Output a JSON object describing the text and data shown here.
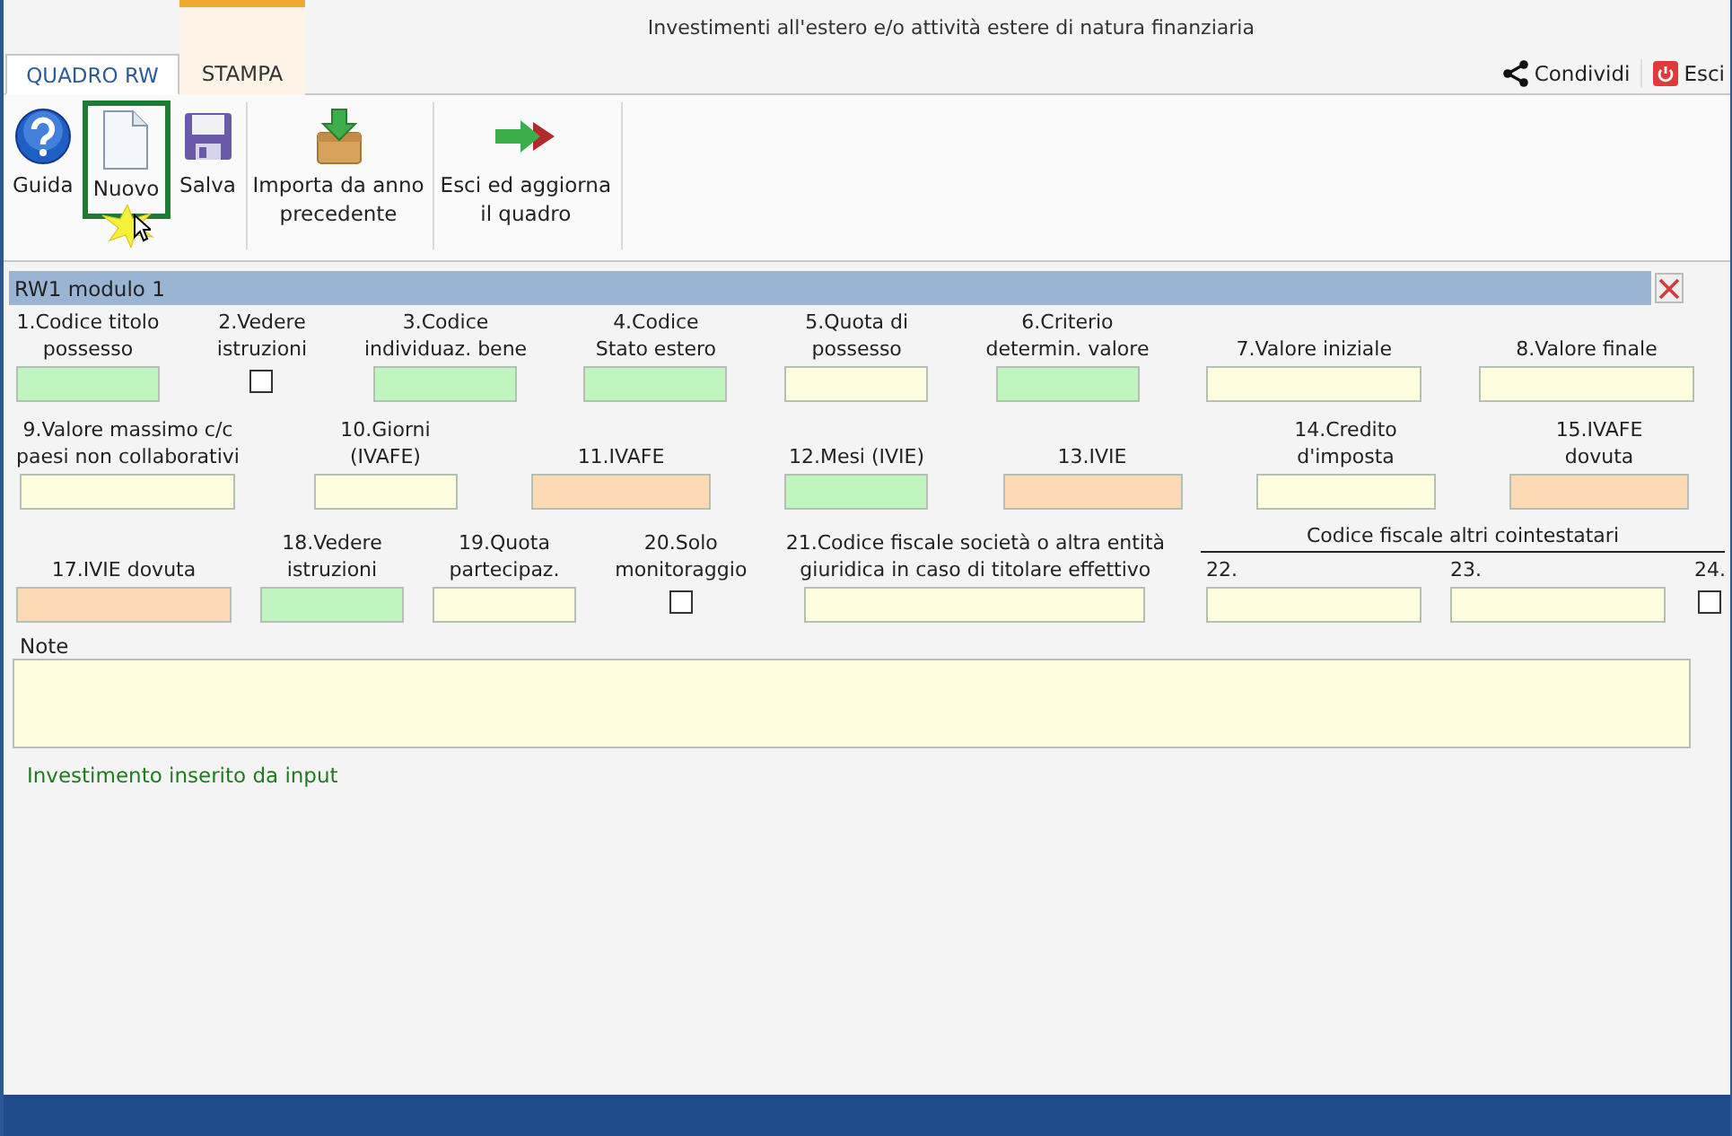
{
  "window": {
    "title": "Investimenti all'estero e/o attività estere di natura finanziaria"
  },
  "tabs": [
    {
      "label": "QUADRO RW",
      "selected": true
    },
    {
      "label": "STAMPA",
      "selected": false
    }
  ],
  "header_actions": [
    {
      "label": "Condividi",
      "kind": "share"
    },
    {
      "label": "Esci",
      "kind": "exit"
    }
  ],
  "toolbar": [
    [
      {
        "label": "Guida",
        "kind": "help",
        "highlighted": false
      },
      {
        "label": "Nuovo",
        "kind": "new",
        "highlighted": true
      },
      {
        "label": "Salva",
        "kind": "save",
        "highlighted": false
      }
    ],
    [
      {
        "label": "Importa da anno\nprecedente",
        "kind": "import",
        "highlighted": false
      }
    ],
    [
      {
        "label": "Esci ed aggiorna\nil quadro",
        "kind": "exit-update",
        "highlighted": false
      }
    ]
  ],
  "section": {
    "title": "RW1 modulo 1",
    "field_groups": [
      [
        {
          "label": "1.Codice titolo\npossesso",
          "kind": "text",
          "color": "#bff5bf"
        },
        {
          "label": "2.Vedere\nistruzioni",
          "kind": "checkbox",
          "checked": false
        },
        {
          "label": "3.Codice\nindividuaz. bene",
          "kind": "text",
          "color": "#bff5bf"
        },
        {
          "label": "4.Codice\nStato estero",
          "kind": "text",
          "color": "#bff5bf"
        },
        {
          "label": "5.Quota di\npossesso",
          "kind": "text",
          "color": "#ffffe0"
        },
        {
          "label": "6.Criterio\ndetermin. valore",
          "kind": "text",
          "color": "#bff5bf"
        },
        {
          "label": "7.Valore iniziale",
          "kind": "text",
          "color": "#ffffe0"
        },
        {
          "label": "8.Valore finale",
          "kind": "text",
          "color": "#ffffe0"
        }
      ],
      [
        {
          "label": "9.Valore massimo c/c\npaesi non collaborativi",
          "kind": "text",
          "color": "#ffffe0"
        },
        {
          "label": "10.Giorni\n(IVAFE)",
          "kind": "text",
          "color": "#ffffe0"
        },
        {
          "label": "11.IVAFE",
          "kind": "text",
          "color": "#fdd9b5"
        },
        {
          "label": "12.Mesi (IVIE)",
          "kind": "text",
          "color": "#bff5bf"
        },
        {
          "label": "13.IVIE",
          "kind": "text",
          "color": "#fdd9b5"
        },
        {
          "label": "14.Credito\nd'imposta",
          "kind": "text",
          "color": "#ffffe0"
        },
        {
          "label": "15.IVAFE\ndovuta",
          "kind": "text",
          "color": "#fdd9b5"
        }
      ],
      [
        {
          "label": "17.IVIE dovuta",
          "kind": "text",
          "color": "#fdd9b5"
        },
        {
          "label": "18.Vedere\nistruzioni",
          "kind": "text",
          "color": "#bff5bf"
        },
        {
          "label": "19.Quota\npartecipaz.",
          "kind": "text",
          "color": "#ffffe0"
        },
        {
          "label": "20.Solo\nmonitoraggio",
          "kind": "checkbox",
          "checked": false
        },
        {
          "label": "21.Codice fiscale società o altra entità\ngiuridica in caso di titolare effettivo",
          "kind": "text",
          "color": "#ffffe0"
        }
      ]
    ],
    "cointestatari": {
      "title": "Codice fiscale altri cointestatari",
      "fields": [
        {
          "label": "22.",
          "kind": "text",
          "color": "#ffffe0"
        },
        {
          "label": "23.",
          "kind": "text",
          "color": "#ffffe0"
        },
        {
          "label": "24.",
          "kind": "checkbox",
          "checked": false
        }
      ]
    },
    "note": {
      "label": "Note",
      "color": "#ffffe0"
    },
    "status": "Investimento inserito da input"
  }
}
